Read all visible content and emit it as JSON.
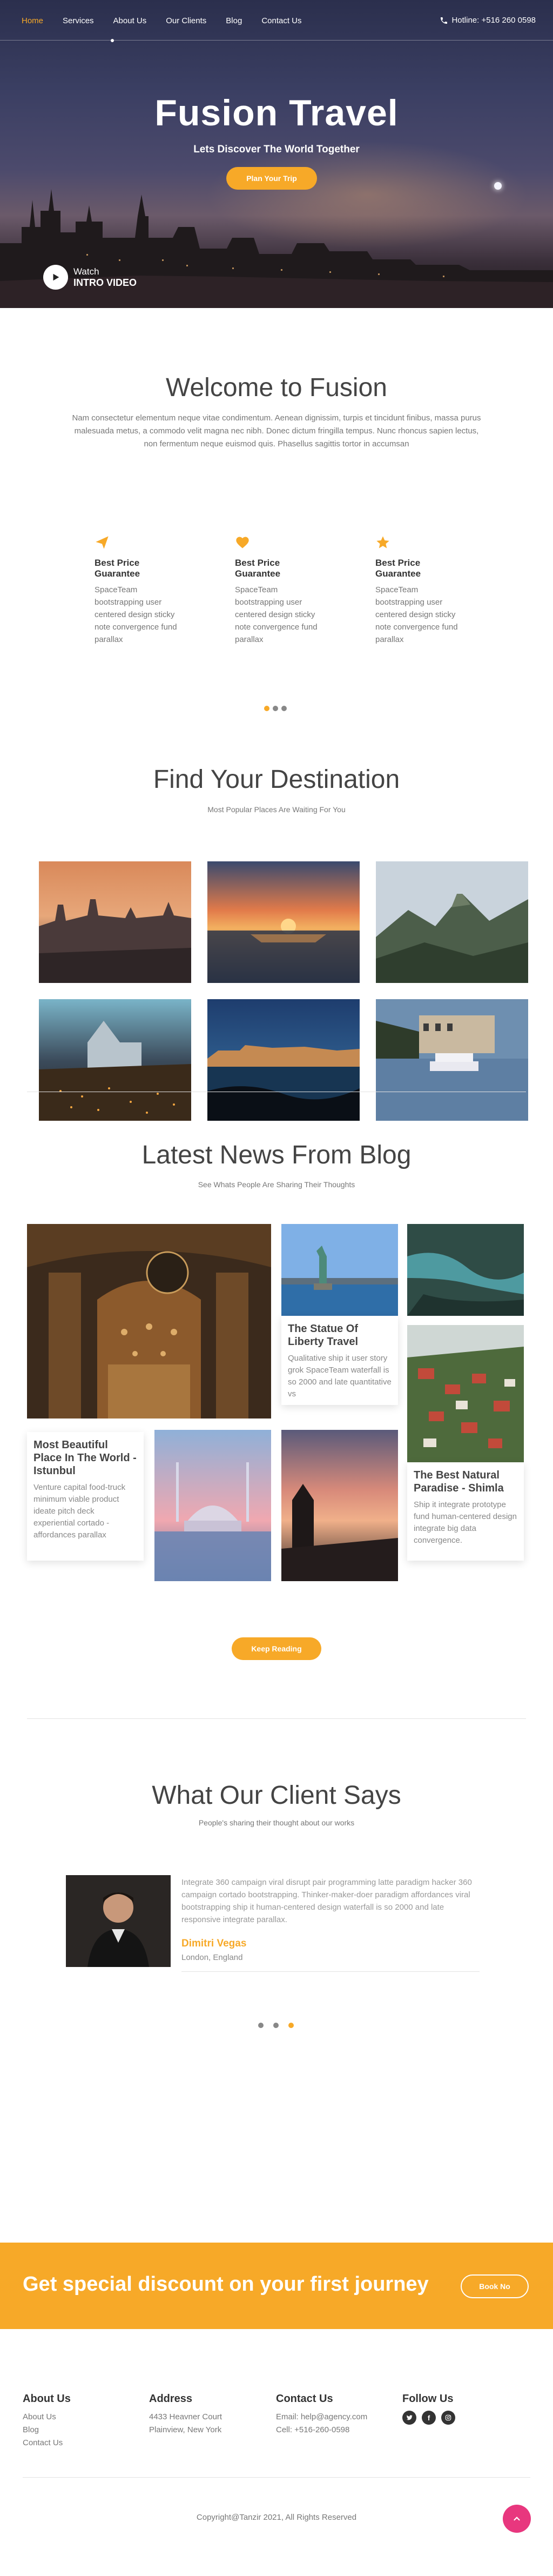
{
  "nav": {
    "items": [
      "Home",
      "Services",
      "About Us",
      "Our Clients",
      "Blog",
      "Contact Us"
    ],
    "active": "Home",
    "hotline": "Hotline: +516 260 0598"
  },
  "hero": {
    "title": "Fusion Travel",
    "tagline": "Lets Discover The World Together",
    "cta": "Plan Your Trip",
    "watch_line1": "Watch",
    "watch_line2": "INTRO VIDEO"
  },
  "welcome": {
    "title": "Welcome to Fusion",
    "text": "Nam consectetur elementum neque vitae condimentum. Aenean dignissim, turpis et tincidunt finibus, massa purus malesuada metus, a commodo velit magna nec nibh. Donec dictum fringilla tempus. Nunc rhoncus sapien lectus, non fermentum neque euismod quis. Phasellus sagittis tortor in accumsan",
    "features": [
      {
        "icon": "paper-plane-icon",
        "title": "Best Price Guarantee",
        "text": "SpaceTeam bootstrapping user centered design sticky note convergence fund parallax"
      },
      {
        "icon": "heart-icon",
        "title": "Best Price Guarantee",
        "text": "SpaceTeam bootstrapping user centered design sticky note convergence fund parallax"
      },
      {
        "icon": "star-icon",
        "title": "Best Price Guarantee",
        "text": "SpaceTeam bootstrapping user centered design sticky note convergence fund parallax"
      }
    ],
    "carousel_active": 0
  },
  "destinations": {
    "title": "Find Your Destination",
    "subtitle": "Most Popular Places Are Waiting For You"
  },
  "blog": {
    "title": "Latest News From Blog",
    "subtitle": "See Whats People Are Sharing Their Thoughts",
    "posts": [
      {
        "title": "The Statue Of Liberty Travel",
        "text": "Qualitative ship it user story grok SpaceTeam waterfall is so 2000 and late quantitative vs"
      },
      {
        "title": "Most Beautiful Place In The World - Istunbul",
        "text": "Venture capital food-truck minimum viable product ideate pitch deck experiential cortado - affordances parallax"
      },
      {
        "title": "The Best Natural Paradise - Shimla",
        "text": "Ship it integrate prototype fund human-centered design integrate big data convergence."
      }
    ],
    "button": "Keep Reading"
  },
  "testimonials": {
    "title": "What Our Client Says",
    "subtitle": "People's sharing their thought about our works",
    "quote": "Integrate 360 campaign viral disrupt pair programming latte paradigm hacker 360 campaign cortado bootstrapping. Thinker-maker-doer paradigm affordances viral bootstrapping ship it human-centered design waterfall is so 2000 and late responsive integrate parallax.",
    "name": "Dimitri Vegas",
    "location": "London, England",
    "carousel_active": 2
  },
  "cta": {
    "text": "Get special discount on your first journey",
    "button": "Book No"
  },
  "footer": {
    "about": {
      "title": "About Us",
      "links": [
        "About Us",
        "Blog",
        "Contact Us"
      ]
    },
    "address": {
      "title": "Address",
      "lines": [
        "4433 Heavner Court",
        "Plainview, New York"
      ]
    },
    "contact": {
      "title": "Contact Us",
      "lines": [
        "Email: help@agency.com",
        "Cell: +516-260-0598"
      ]
    },
    "follow": {
      "title": "Follow Us",
      "icons": [
        "twitter-icon",
        "facebook-icon",
        "instagram-icon"
      ]
    },
    "copyright": "Copyright@Tanzir 2021, All Rights Reserved"
  },
  "colors": {
    "accent": "#f7a928",
    "pink": "#e8377e",
    "heading": "#444444"
  }
}
